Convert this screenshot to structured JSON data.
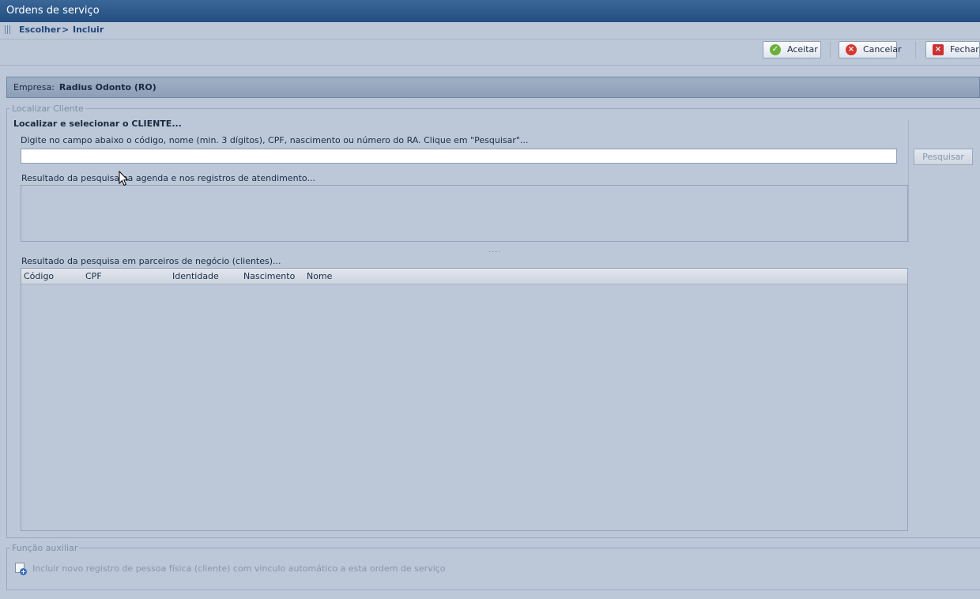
{
  "window": {
    "title": "Ordens de serviço"
  },
  "breadcrumb": {
    "step1": "Escolher",
    "separator": ">",
    "step2": "Incluir"
  },
  "toolbar": {
    "accept_label": "Aceitar",
    "cancel_label": "Cancelar",
    "close_label": "Fechar"
  },
  "company": {
    "label": "Empresa:",
    "value": "Radius Odonto (RO)"
  },
  "find_client": {
    "legend": "Localizar Cliente",
    "heading": "Localizar e selecionar o CLIENTE...",
    "instruction": "Digite no campo abaixo o código, nome (min. 3 dígitos), CPF, nascimento ou número do RA. Clique em \"Pesquisar\"...",
    "search_value": "",
    "search_button": "Pesquisar",
    "agenda_results_label": "Resultado da pesquisa na agenda e nos registros de atendimento...",
    "splitter_glyph": "....",
    "partner_results_label": "Resultado da pesquisa em parceiros de negócio (clientes)...",
    "columns": [
      "Código",
      "CPF",
      "Identidade",
      "Nascimento",
      "Nome"
    ]
  },
  "aux": {
    "legend": "Função auxiliar",
    "include_text": "Incluir novo registro de pessoa física (cliente) com vinculo automático a esta ordem de serviço"
  },
  "colors": {
    "titlebar": "#234f80",
    "background": "#bcc8d8",
    "accept_icon": "#6bb03a",
    "cancel_icon": "#d9352b",
    "close_icon": "#cf2f2f"
  },
  "icons": {
    "accept": "check-circle-icon",
    "cancel": "x-circle-icon",
    "close": "x-square-icon",
    "aux": "new-record-icon",
    "grip": "grip-icon",
    "cursor": "mouse-pointer-icon"
  }
}
